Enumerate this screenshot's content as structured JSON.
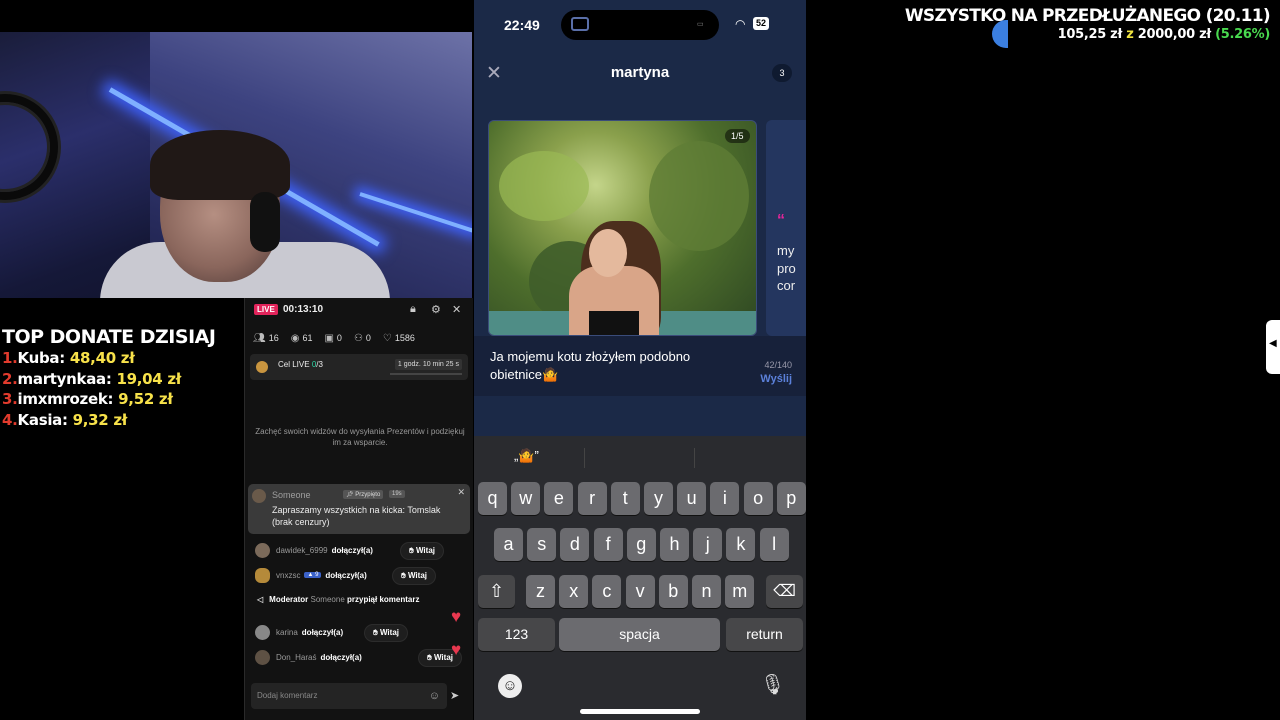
{
  "donate": {
    "title": "TOP DONATE DZISIAJ",
    "rows": [
      {
        "num": "1.",
        "name": "Kuba:",
        "amount": "48,40 zł"
      },
      {
        "num": "2.",
        "name": "martynkaa:",
        "amount": "19,04 zł"
      },
      {
        "num": "3.",
        "name": "imxmrozek:",
        "amount": "9,52 zł"
      },
      {
        "num": "4.",
        "name": "Kasia:",
        "amount": "9,32 zł"
      }
    ]
  },
  "stream": {
    "live_badge": "LIVE",
    "timer": "00:13:10",
    "stats": {
      "users": "16",
      "views": "61",
      "gifts": "0",
      "follows": "0",
      "likes": "1586"
    },
    "goal_label": "Cel LIVE",
    "goal_progress": "0",
    "goal_total": "/3",
    "goal_time": "1 godz. 10 min 25 s",
    "encourage": "Zachęć swoich widzów do wysyłania Prezentów i podziękuj im za wsparcie.",
    "pinned": {
      "user": "Someone",
      "tag": "Przypięto",
      "time": "19s",
      "message": "Zapraszamy wszystkich na kicka: Tomslak (brak cenzury)"
    },
    "chat": [
      {
        "user": "dawidek_6999",
        "action": "dołączył(a)",
        "button": "Witaj"
      },
      {
        "user": "vnxzsc",
        "badge": "9",
        "action": "dołączył(a)",
        "button": "Witaj"
      },
      {
        "user": "karina",
        "action": "dołączył(a)",
        "button": "Witaj"
      },
      {
        "user": "Don_Haraś",
        "action": "dołączył(a)",
        "button": "Witaj"
      }
    ],
    "moderator": {
      "prefix": "Moderator",
      "name": "Someone",
      "action": "przypiął komentarz"
    },
    "comment_placeholder": "Dodaj komentarz"
  },
  "phone": {
    "time": "22:49",
    "battery": "52",
    "title": "martyna",
    "count": "3",
    "photo_counter": "1/5",
    "card2_quote": "“",
    "card2_text": [
      "my",
      "pro",
      "cor"
    ],
    "message": "Ja mojemu kotu złożyłem podobno obietnice🤷",
    "char_count": "42/140",
    "send_label": "Wyślij",
    "suggestion": "„🤷”",
    "keys_row1": [
      "q",
      "w",
      "e",
      "r",
      "t",
      "y",
      "u",
      "i",
      "o",
      "p"
    ],
    "keys_row2": [
      "a",
      "s",
      "d",
      "f",
      "g",
      "h",
      "j",
      "k",
      "l"
    ],
    "keys_row3": [
      "z",
      "x",
      "c",
      "v",
      "b",
      "n",
      "m"
    ],
    "key_123": "123",
    "key_space": "spacja",
    "key_return": "return"
  },
  "goal_overlay": {
    "title": "WSZYSTKO NA PRZEDŁUŻANEGO (20.11)",
    "current": "105,25 zł",
    "sep": "z",
    "target": "2000,00 zł",
    "percent": "(5.26%)"
  },
  "colors": {
    "live": "#e2245b",
    "donate_amount": "#f8e24a",
    "donate_num": "#e23b2d",
    "percent": "#49d94f",
    "send": "#5b80d9"
  }
}
